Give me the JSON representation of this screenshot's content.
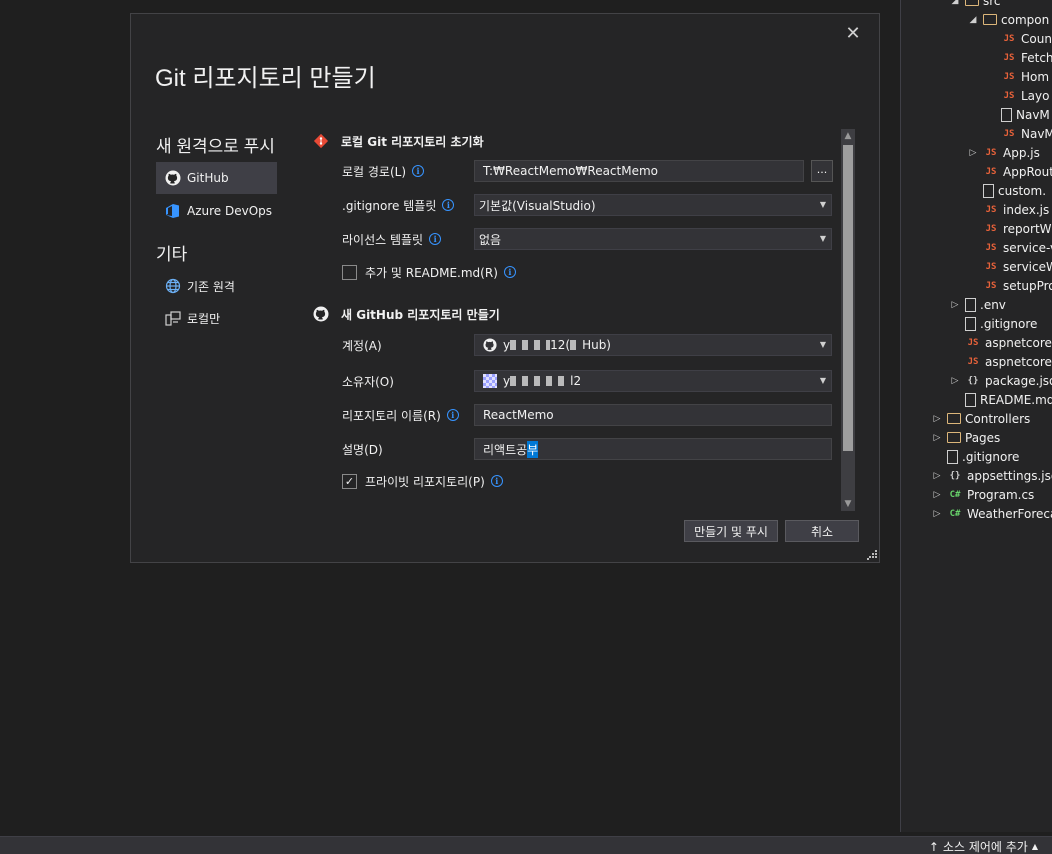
{
  "dialog": {
    "title": "Git 리포지토리 만들기",
    "close_glyph": "✕",
    "push_heading": "새 원격으로 푸시",
    "push_items": [
      {
        "label": "GitHub",
        "icon": "github-icon",
        "active": true
      },
      {
        "label": "Azure DevOps",
        "icon": "azure-devops-icon",
        "active": false
      }
    ],
    "other_heading": "기타",
    "other_items": [
      {
        "label": "기존 원격",
        "icon": "globe-icon"
      },
      {
        "label": "로컬만",
        "icon": "local-computer-icon"
      }
    ],
    "local_section": {
      "title": "로컬 Git 리포지토리 초기화",
      "path_label": "로컬 경로(L)",
      "path_value": "T:₩ReactMemo₩ReactMemo",
      "browse_label": "...",
      "gitignore_label": ".gitignore 템플릿",
      "gitignore_value": "기본값(VisualStudio)",
      "license_label": "라이선스 템플릿",
      "license_value": "없음",
      "readme_label": "추가 및 README.md(R)",
      "readme_checked": false
    },
    "github_section": {
      "title": "새 GitHub 리포지토리 만들기",
      "account_label": "계정(A)",
      "account_value_prefix": "y",
      "account_value_suffix": "12(",
      "account_value_tail": "Hub)",
      "owner_label": "소유자(O)",
      "owner_value_prefix": "y",
      "owner_value_suffix": "l2",
      "repo_name_label": "리포지토리 이름(R)",
      "repo_name_value": "ReactMemo",
      "desc_label": "설명(D)",
      "desc_value_main": "리액트공",
      "desc_value_selected": "부",
      "private_label": "프라이빗 리포지토리(P)",
      "private_checked": true
    },
    "buttons": {
      "create_push": "만들기 및 푸시",
      "cancel": "취소"
    }
  },
  "solution_explorer": {
    "items": [
      {
        "label": "src",
        "icon": "folder-icon",
        "indent": 0,
        "arrow": "◢"
      },
      {
        "label": "compon",
        "icon": "folder-icon",
        "indent": 1,
        "arrow": "◢"
      },
      {
        "label": "Coun",
        "icon": "js-file-icon",
        "indent": 2,
        "arrow": ""
      },
      {
        "label": "Fetch",
        "icon": "js-file-icon",
        "indent": 2,
        "arrow": ""
      },
      {
        "label": "Hom",
        "icon": "js-file-icon",
        "indent": 2,
        "arrow": ""
      },
      {
        "label": "Layo",
        "icon": "js-file-icon",
        "indent": 2,
        "arrow": ""
      },
      {
        "label": "NavM",
        "icon": "file-icon",
        "indent": 2,
        "arrow": ""
      },
      {
        "label": "NavM",
        "icon": "js-file-icon",
        "indent": 2,
        "arrow": ""
      },
      {
        "label": "App.js",
        "icon": "js-file-icon",
        "indent": 1,
        "arrow": "▷"
      },
      {
        "label": "AppRout",
        "icon": "js-file-icon",
        "indent": 1,
        "arrow": ""
      },
      {
        "label": "custom.",
        "icon": "file-icon",
        "indent": 1,
        "arrow": ""
      },
      {
        "label": "index.js",
        "icon": "js-file-icon",
        "indent": 1,
        "arrow": ""
      },
      {
        "label": "reportW",
        "icon": "js-file-icon",
        "indent": 1,
        "arrow": ""
      },
      {
        "label": "service-v",
        "icon": "js-file-icon",
        "indent": 1,
        "arrow": ""
      },
      {
        "label": "serviceW",
        "icon": "js-file-icon",
        "indent": 1,
        "arrow": ""
      },
      {
        "label": "setupPro",
        "icon": "js-file-icon",
        "indent": 1,
        "arrow": ""
      },
      {
        "label": ".env",
        "icon": "file-icon",
        "indent": 0,
        "arrow": "▷"
      },
      {
        "label": ".gitignore",
        "icon": "file-icon",
        "indent": 0,
        "arrow": ""
      },
      {
        "label": "aspnetcore-",
        "icon": "js-file-icon",
        "indent": 0,
        "arrow": ""
      },
      {
        "label": "aspnetcore-",
        "icon": "js-file-icon",
        "indent": 0,
        "arrow": ""
      },
      {
        "label": "package.json",
        "icon": "json-file-icon",
        "indent": 0,
        "arrow": "▷"
      },
      {
        "label": "README.md",
        "icon": "file-icon",
        "indent": 0,
        "arrow": ""
      },
      {
        "label": "Controllers",
        "icon": "folder-icon",
        "indent": -1,
        "arrow": "▷"
      },
      {
        "label": "Pages",
        "icon": "folder-icon",
        "indent": -1,
        "arrow": "▷"
      },
      {
        "label": ".gitignore",
        "icon": "file-icon",
        "indent": -1,
        "arrow": ""
      },
      {
        "label": "appsettings.json",
        "icon": "json-file-icon",
        "indent": -1,
        "arrow": "▷"
      },
      {
        "label": "Program.cs",
        "icon": "cs-file-icon",
        "indent": -1,
        "arrow": "▷"
      },
      {
        "label": "WeatherForecast",
        "icon": "cs-file-icon",
        "indent": -1,
        "arrow": "▷"
      }
    ]
  },
  "status_bar": {
    "source_control": "소스 제어에 추가"
  },
  "colors": {
    "accent": "#3794ff",
    "selection": "#0078d4",
    "js": "#e8623a",
    "cs": "#68d46b",
    "folder": "#dcb67a"
  }
}
